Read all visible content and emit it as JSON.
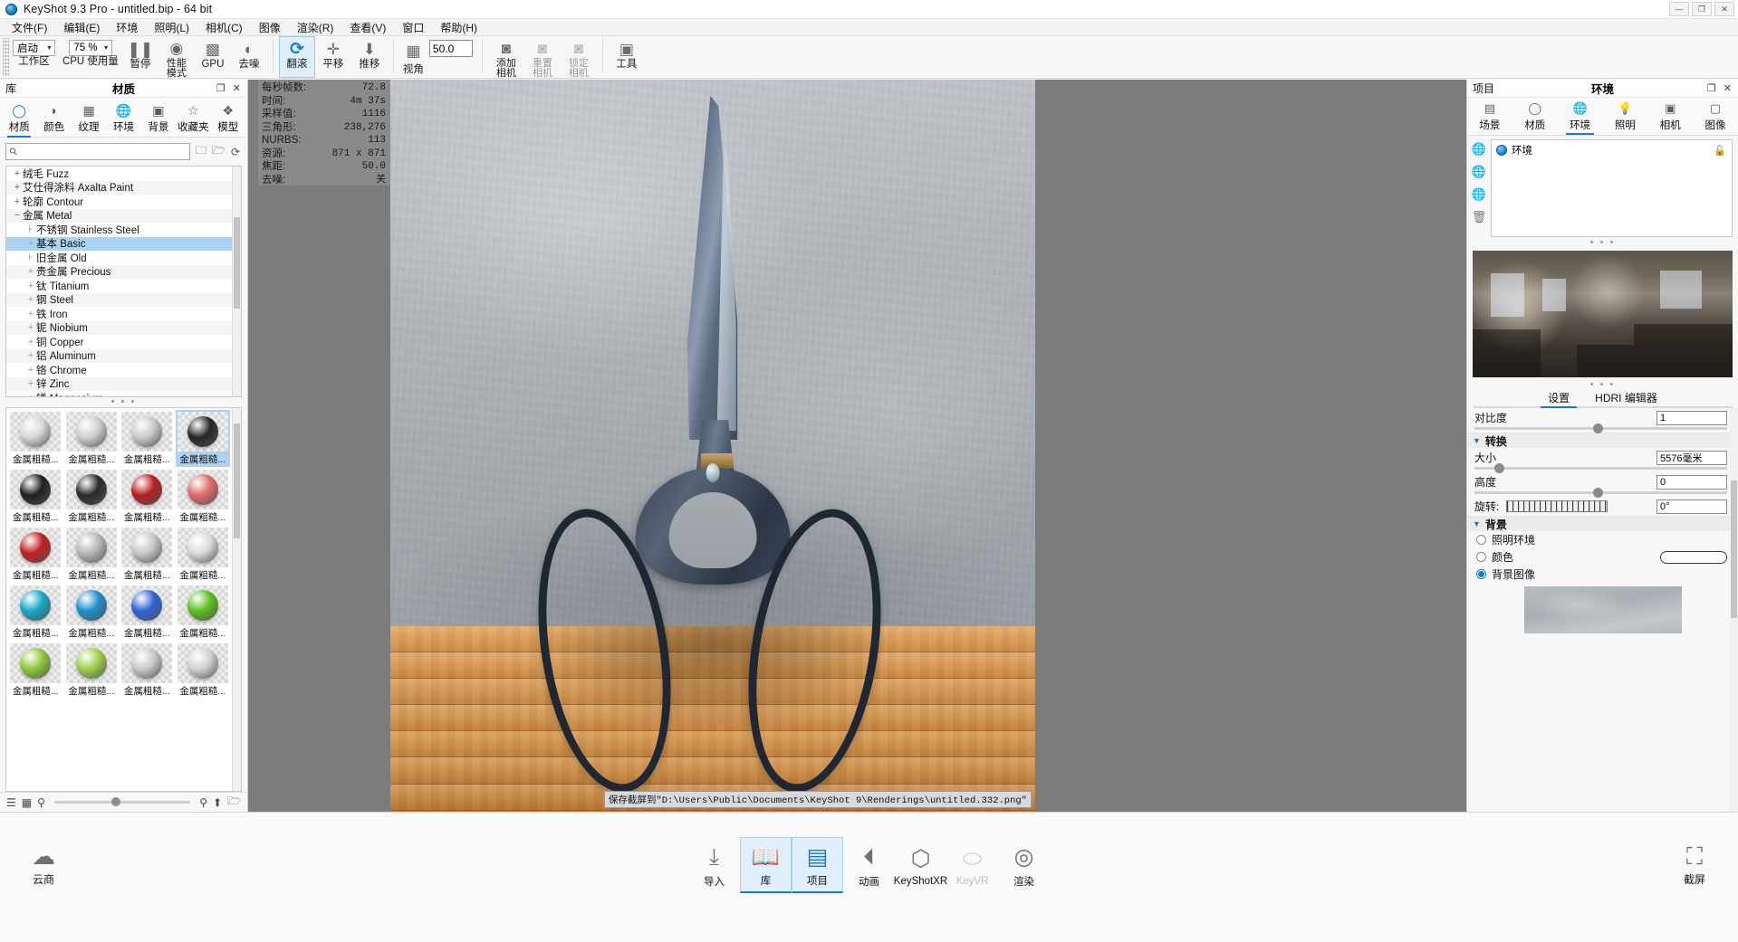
{
  "titlebar": {
    "app_title": "KeyShot 9.3 Pro  - untitled.bip  - 64 bit",
    "logo_icon": "keyshot-logo-icon",
    "minimize": "—",
    "maximize": "❐",
    "close": "✕"
  },
  "menubar": {
    "items": [
      {
        "label": "文件(F)"
      },
      {
        "label": "编辑(E)"
      },
      {
        "label": "环境"
      },
      {
        "label": "照明(L)"
      },
      {
        "label": "相机(C)"
      },
      {
        "label": "图像"
      },
      {
        "label": "渲染(R)"
      },
      {
        "label": "查看(V)"
      },
      {
        "label": "窗口"
      },
      {
        "label": "帮助(H)"
      }
    ]
  },
  "toolbar": {
    "workspace": {
      "label": "工作区",
      "value": "启动",
      "arrow": "▼"
    },
    "cpu_usage": {
      "label": "CPU 使用量",
      "value": "75 %",
      "arrow": "▼"
    },
    "pause": {
      "label": "暂停",
      "icon": "pause-icon",
      "glyph": "❚❚"
    },
    "performance_mode": {
      "label": "性能\n模式",
      "label_line1": "性能",
      "label_line2": "模式",
      "icon": "performance-icon",
      "glyph": "◉"
    },
    "gpu": {
      "label": "GPU",
      "icon": "gpu-chip-icon",
      "glyph": "▩"
    },
    "denoise": {
      "label": "去噪",
      "icon": "denoise-icon",
      "glyph": "◐"
    },
    "tumble": {
      "label": "翻滚",
      "icon": "tumble-rotate-icon",
      "glyph": "⟳",
      "selected": true
    },
    "pan": {
      "label": "平移",
      "icon": "pan-move-icon",
      "glyph": "✛"
    },
    "dolly": {
      "label": "推移",
      "icon": "dolly-arrow-icon",
      "glyph": "⬇"
    },
    "fov": {
      "label": "视角",
      "icon": "fov-grid-icon",
      "glyph": "▦",
      "value": "50.0"
    },
    "add_camera": {
      "label_line1": "添加",
      "label_line2": "相机",
      "icon": "add-camera-icon",
      "glyph": "◙"
    },
    "reset_camera": {
      "label_line1": "重置",
      "label_line2": "相机",
      "icon": "reset-camera-icon",
      "glyph": "◙"
    },
    "lock_camera": {
      "label_line1": "锁定",
      "label_line2": "相机",
      "icon": "lock-camera-icon",
      "glyph": "◙"
    },
    "tools": {
      "label": "工具",
      "icon": "tools-icon",
      "glyph": "▣"
    }
  },
  "library": {
    "header_left": "库",
    "header_title": "材质",
    "restore_icon": "restore-window-icon",
    "close_icon": "close-icon",
    "tabs": [
      {
        "label": "材质",
        "icon": "material-ball-icon",
        "glyph": "◯",
        "selected": true
      },
      {
        "label": "颜色",
        "icon": "color-swatch-icon",
        "glyph": "◗",
        "selected": false
      },
      {
        "label": "纹理",
        "icon": "texture-checker-icon",
        "glyph": "▦",
        "selected": false
      },
      {
        "label": "环境",
        "icon": "environment-globe-icon",
        "glyph": "🌐",
        "selected": false
      },
      {
        "label": "背景",
        "icon": "background-image-icon",
        "glyph": "▣",
        "selected": false
      },
      {
        "label": "收藏夹",
        "icon": "favorites-star-icon",
        "glyph": "☆",
        "selected": false
      },
      {
        "label": "模型",
        "icon": "model-cubes-icon",
        "glyph": "❖",
        "selected": false
      }
    ],
    "search": {
      "placeholder": "",
      "value": "",
      "icon": "search-icon"
    },
    "search_buttons": [
      {
        "name": "folder-icon",
        "glyph": "🗀"
      },
      {
        "name": "folder-import-icon",
        "glyph": "🗁"
      },
      {
        "name": "refresh-icon",
        "glyph": "⟳"
      }
    ],
    "tree": [
      {
        "label": "绒毛 Fuzz",
        "expander": "+",
        "level": 1,
        "selected": false
      },
      {
        "label": "艾仕得涂料 Axalta Paint",
        "expander": "+",
        "level": 1,
        "selected": false
      },
      {
        "label": "轮廓 Contour",
        "expander": "+",
        "level": 1,
        "selected": false
      },
      {
        "label": "金属 Metal",
        "expander": "−",
        "level": 1,
        "selected": false
      },
      {
        "label": "不锈钢 Stainless Steel",
        "expander": "⊦",
        "level": 2,
        "selected": false
      },
      {
        "label": "基本 Basic",
        "expander": "+",
        "level": 2,
        "selected": true
      },
      {
        "label": "旧金属 Old",
        "expander": "⊦",
        "level": 2,
        "selected": false
      },
      {
        "label": "贵金属 Precious",
        "expander": "+",
        "level": 2,
        "selected": false
      },
      {
        "label": "钛 Titanium",
        "expander": "+",
        "level": 2,
        "selected": false
      },
      {
        "label": "钢 Steel",
        "expander": "+",
        "level": 2,
        "selected": false
      },
      {
        "label": "铁 Iron",
        "expander": "+",
        "level": 2,
        "selected": false
      },
      {
        "label": "铌 Niobium",
        "expander": "+",
        "level": 2,
        "selected": false
      },
      {
        "label": "铜 Copper",
        "expander": "+",
        "level": 2,
        "selected": false
      },
      {
        "label": "铝 Aluminum",
        "expander": "+",
        "level": 2,
        "selected": false
      },
      {
        "label": "铬 Chrome",
        "expander": "+",
        "level": 2,
        "selected": false
      },
      {
        "label": "锌 Zinc",
        "expander": "+",
        "level": 2,
        "selected": false
      },
      {
        "label": "镁 Magnesium",
        "expander": "+",
        "level": 2,
        "selected": false
      }
    ],
    "thumbnail_label": "金属粗糙...",
    "thumbnails": [
      {
        "label": "金属粗糙...",
        "color": "#d8d8d8",
        "selected": false
      },
      {
        "label": "金属粗糙...",
        "color": "#cfcfcf",
        "selected": false
      },
      {
        "label": "金属粗糙...",
        "color": "#cacaca",
        "selected": false
      },
      {
        "label": "金属粗糙...",
        "color": "#262626",
        "selected": true
      },
      {
        "label": "金属粗糙...",
        "color": "#1f1f1f",
        "selected": false
      },
      {
        "label": "金属粗糙...",
        "color": "#2a2a2a",
        "selected": false
      },
      {
        "label": "金属粗糙...",
        "color": "#b81f1f",
        "selected": false
      },
      {
        "label": "金属粗糙...",
        "color": "#e06a6a",
        "selected": false
      },
      {
        "label": "金属粗糙...",
        "color": "#c02020",
        "selected": false
      },
      {
        "label": "金属粗糙...",
        "color": "#b9b9b9",
        "selected": false
      },
      {
        "label": "金属粗糙...",
        "color": "#c8c8c8",
        "selected": false
      },
      {
        "label": "金属粗糙...",
        "color": "#dcdcdc",
        "selected": false
      },
      {
        "label": "金属粗糙...",
        "color": "#18a7c8",
        "selected": false
      },
      {
        "label": "金属粗糙...",
        "color": "#1e8fd0",
        "selected": false
      },
      {
        "label": "金属粗糙...",
        "color": "#2f63d8",
        "selected": false
      },
      {
        "label": "金属粗糙...",
        "color": "#5cc020",
        "selected": false
      },
      {
        "label": "金属粗糙...",
        "color": "#8ec93a",
        "selected": false
      },
      {
        "label": "金属粗糙...",
        "color": "#9ed04a",
        "selected": false
      },
      {
        "label": "金属粗糙...",
        "color": "#c9c9c9",
        "selected": false
      },
      {
        "label": "金属粗糙...",
        "color": "#d2d2d2",
        "selected": false
      }
    ],
    "bottom_icons": [
      {
        "name": "list-view-icon",
        "glyph": "☰"
      },
      {
        "name": "grid-view-icon",
        "glyph": "▦"
      },
      {
        "name": "zoom-out-icon",
        "glyph": "⌕"
      },
      {
        "name": "zoom-in-icon",
        "glyph": "⌕"
      },
      {
        "name": "download-icon",
        "glyph": "⬆"
      },
      {
        "name": "folder-open-icon",
        "glyph": "🗁"
      }
    ]
  },
  "stats": {
    "rows": [
      {
        "key": "每秒帧数:",
        "value": "72.8"
      },
      {
        "key": "时间:",
        "value": "4m 37s"
      },
      {
        "key": "采样值:",
        "value": "1116"
      },
      {
        "key": "三角形:",
        "value": "238,276"
      },
      {
        "key": "NURBS:",
        "value": "113"
      },
      {
        "key": "资源:",
        "value": "871 x 871"
      },
      {
        "key": "焦距:",
        "value": "50.0"
      },
      {
        "key": "去噪:",
        "value": "关"
      }
    ]
  },
  "viewport": {
    "status_message": "保存截屏到\"D:\\Users\\Public\\Documents\\KeyShot 9\\Renderings\\untitled.332.png\""
  },
  "project": {
    "header_left": "项目",
    "header_title": "环境",
    "restore_icon": "restore-window-icon",
    "close_icon": "close-icon",
    "tabs": [
      {
        "label": "场景",
        "icon": "scene-list-icon",
        "glyph": "▤",
        "selected": false
      },
      {
        "label": "材质",
        "icon": "material-ball-icon",
        "glyph": "◯",
        "selected": false
      },
      {
        "label": "环境",
        "icon": "environment-globe-icon",
        "glyph": "🌐",
        "selected": true
      },
      {
        "label": "照明",
        "icon": "lighting-bulb-icon",
        "glyph": "💡",
        "selected": false
      },
      {
        "label": "相机",
        "icon": "camera-icon",
        "glyph": "▣",
        "selected": false
      },
      {
        "label": "图像",
        "icon": "image-frame-icon",
        "glyph": "▢",
        "selected": false
      }
    ],
    "side_icons": [
      {
        "name": "environment-globe-icon",
        "glyph": "🌐"
      },
      {
        "name": "add-environment-icon",
        "glyph": "🌐"
      },
      {
        "name": "duplicate-environment-icon",
        "glyph": "🌐"
      },
      {
        "name": "delete-environment-icon",
        "glyph": "🗑"
      }
    ],
    "env_list": [
      {
        "label": "环境",
        "icon": "environment-globe-icon",
        "lock_icon": "lock-icon"
      }
    ],
    "dots": "• • •",
    "settings_tabs": [
      {
        "label": "设置",
        "selected": true
      },
      {
        "label": "HDRI 编辑器",
        "selected": false
      }
    ],
    "contrast": {
      "label": "对比度",
      "value": "1"
    },
    "transform_section": {
      "title": "转换",
      "chevron": "▼",
      "size": {
        "label": "大小",
        "value": "5576毫米"
      },
      "height": {
        "label": "高度",
        "value": "0"
      },
      "rotation": {
        "label": "旋转:",
        "value": "0°"
      }
    },
    "background_section": {
      "title": "背景",
      "chevron": "▼",
      "options": [
        {
          "label": "照明环境",
          "selected": false
        },
        {
          "label": "颜色",
          "selected": false
        },
        {
          "label": "背景图像",
          "selected": true
        }
      ],
      "color_swatch": "#fefefe"
    }
  },
  "bottombar": {
    "cloud": {
      "label": "云商",
      "icon": "cloud-library-icon",
      "glyph": "☁"
    },
    "items": [
      {
        "label": "导入",
        "icon": "import-icon",
        "glyph": "⤓",
        "selected": false,
        "dim": false
      },
      {
        "label": "库",
        "icon": "library-book-icon",
        "glyph": "📖",
        "selected": true,
        "dim": false
      },
      {
        "label": "项目",
        "icon": "project-panel-icon",
        "glyph": "▤",
        "selected": true,
        "dim": false
      },
      {
        "label": "动画",
        "icon": "animation-play-icon",
        "glyph": "⏴",
        "selected": false,
        "dim": false
      },
      {
        "label": "KeyShotXR",
        "icon": "keyshotxr-icon",
        "glyph": "⬡",
        "selected": false,
        "dim": false
      },
      {
        "label": "KeyVR",
        "icon": "keyvr-headset-icon",
        "glyph": "⬭",
        "selected": false,
        "dim": true
      },
      {
        "label": "渲染",
        "icon": "render-camera-icon",
        "glyph": "◎",
        "selected": false,
        "dim": false
      }
    ],
    "screenshot": {
      "label": "截屏",
      "icon": "screenshot-icon",
      "glyph": "⛶"
    }
  }
}
